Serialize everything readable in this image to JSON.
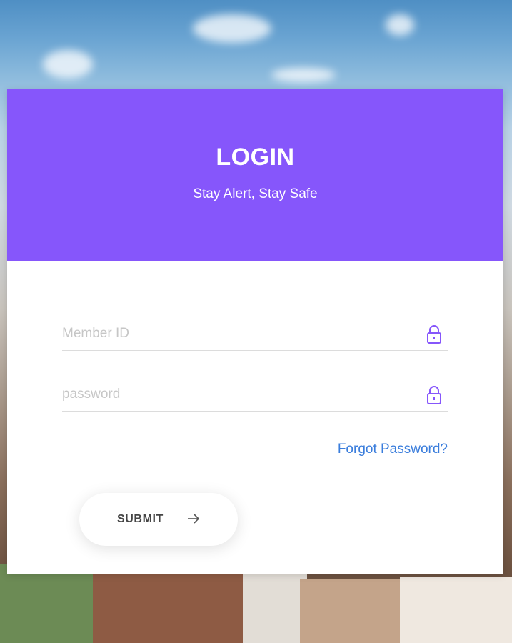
{
  "header": {
    "title": "LOGIN",
    "subtitle": "Stay Alert, Stay Safe"
  },
  "form": {
    "member_id": {
      "placeholder": "Member ID",
      "value": "",
      "icon": "lock-icon"
    },
    "password": {
      "placeholder": "password",
      "value": "",
      "icon": "lock-icon"
    },
    "forgot_label": "Forgot Password?",
    "submit_label": "SUBMIT",
    "submit_icon": "arrow-right-icon"
  },
  "colors": {
    "accent": "#8656fb",
    "link": "#3a7ddc",
    "card": "#ffffff"
  }
}
